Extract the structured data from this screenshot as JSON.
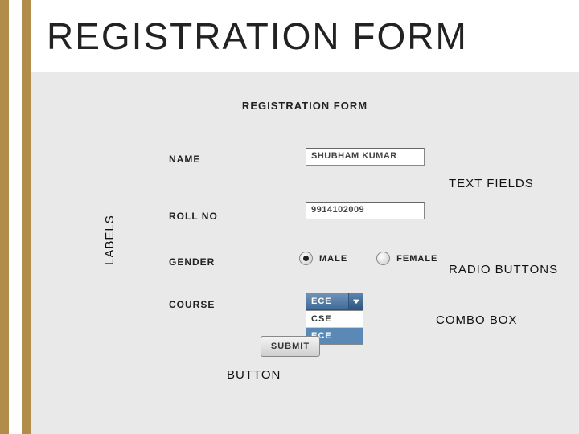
{
  "title": "REGISTRATION FORM",
  "form": {
    "heading": "REGISTRATION FORM",
    "labels": {
      "name": "NAME",
      "roll": "ROLL NO",
      "gender": "GENDER",
      "course": "COURSE"
    },
    "inputs": {
      "name_value": "SHUBHAM KUMAR",
      "roll_value": "9914102009"
    },
    "gender_options": {
      "male": "MALE",
      "female": "FEMALE",
      "selected": "MALE"
    },
    "course": {
      "selected": "ECE",
      "options": [
        "CSE",
        "ECE"
      ]
    },
    "submit_label": "SUBMIT"
  },
  "annotations": {
    "labels": "LABELS",
    "textfields": "TEXT FIELDS",
    "radio": "RADIO BUTTONS",
    "combo": "COMBO BOX",
    "button": "BUTTON"
  }
}
